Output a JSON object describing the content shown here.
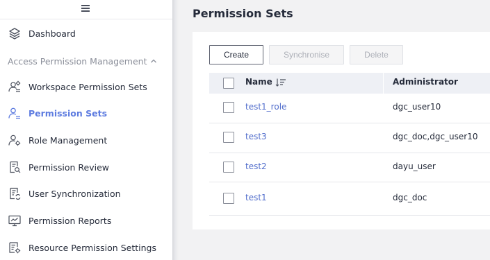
{
  "sidebar": {
    "menu_icon": "hamburger-menu-icon",
    "dashboard": {
      "label": "Dashboard",
      "icon": "layers-icon"
    },
    "group": {
      "label": "Access Permission Management",
      "icon": "chevron-up-icon",
      "expanded": true
    },
    "items": [
      {
        "label": "Workspace Permission Sets",
        "icon": "users-settings-icon",
        "active": false
      },
      {
        "label": "Permission Sets",
        "icon": "user-permission-icon",
        "active": true
      },
      {
        "label": "Role Management",
        "icon": "user-gear-icon",
        "active": false
      },
      {
        "label": "Permission Review",
        "icon": "document-review-icon",
        "active": false
      },
      {
        "label": "User Synchronization",
        "icon": "document-sync-icon",
        "active": false
      },
      {
        "label": "Permission Reports",
        "icon": "report-monitor-icon",
        "active": false
      },
      {
        "label": "Resource Permission Settings",
        "icon": "resource-settings-icon",
        "active": false
      }
    ]
  },
  "main": {
    "title": "Permission Sets",
    "toolbar": {
      "create_label": "Create",
      "sync_label": "Synchronise",
      "delete_label": "Delete"
    },
    "table": {
      "columns": {
        "name": "Name",
        "administrator": "Administrator"
      },
      "sort_icon": "sort-descending-icon",
      "rows": [
        {
          "name": "test1_role",
          "administrator": "dgc_user10"
        },
        {
          "name": "test3",
          "administrator": "dgc_doc,dgc_user10"
        },
        {
          "name": "test2",
          "administrator": "dayu_user"
        },
        {
          "name": "test1",
          "administrator": "dgc_doc"
        }
      ]
    }
  },
  "colors": {
    "accent": "#5e7ce0",
    "link": "#526ecc",
    "table_header_bg": "#eef0f5",
    "page_bg": "#f2f2f3"
  }
}
